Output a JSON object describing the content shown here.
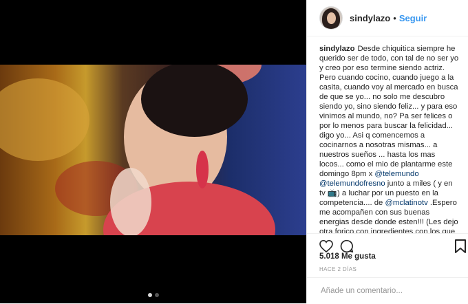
{
  "post": {
    "username": "sindylazo",
    "separator": "•",
    "follow_label": "Seguir",
    "caption": {
      "username": "sindylazo",
      "text_1": "Desde chiquitica siempre he querido ser de todo, con tal de no ser yo y creo por eso termine siendo actriz. Pero cuando cocino, cuando juego a la casita, cuando voy al mercado en busca de que se yo... no solo me descubro siendo yo, sino siendo feliz... y para eso vinimos al mundo, no? Pa ser felices o por lo menos para buscar la felicidad... digo yo... Asi q comencemos a cocinarnos a nosotras mismas... a nuestros sueños ... hasta los mas locos... como el mio de plantarme este domingo 8pm x ",
      "mention_1": "@telemundo",
      "space_1": " ",
      "mention_2": "@telemundofresno",
      "text_2": " junto a miles ( y en tv 📺) a luchar por un puesto en la competencia.... de ",
      "mention_3": "@mclatinotv",
      "text_3": " .Espero me acompañen con sus buenas energias desde donde esten!!! (Les dejo otra forico con ingredientes con los que pienso ya mismo montar una sopita... tip: siempre a"
    },
    "icons": {
      "like": "heart-icon",
      "comment": "comment-icon",
      "save": "bookmark-icon"
    },
    "likes": "5.018 Me gusta",
    "time": "HACE 2 DÍAS",
    "comment_placeholder": "Añade un comentario...",
    "carousel": {
      "total": 2,
      "active": 1
    }
  }
}
